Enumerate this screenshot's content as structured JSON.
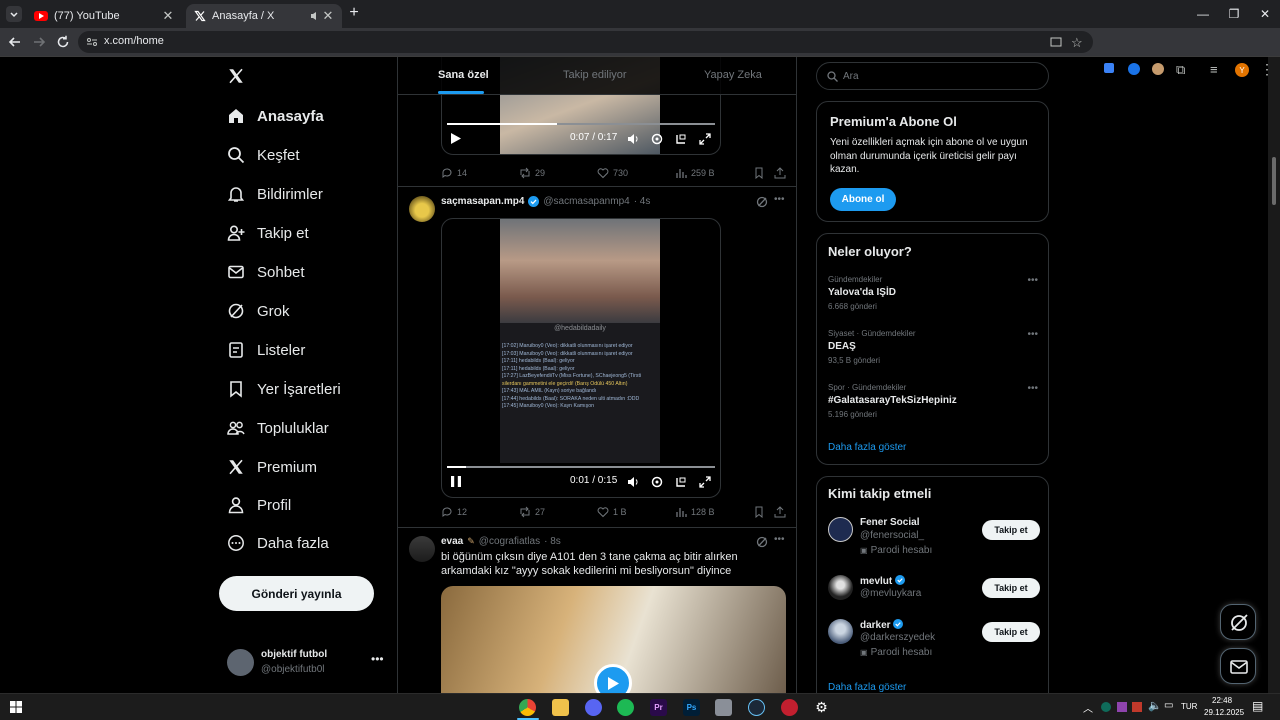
{
  "browser": {
    "tabs": [
      {
        "title": "(77) YouTube",
        "active": false
      },
      {
        "title": "Anasayfa / X",
        "active": true
      }
    ],
    "url": "x.com/home"
  },
  "nav": {
    "items": [
      {
        "label": "Anasayfa",
        "icon": "home-icon"
      },
      {
        "label": "Keşfet",
        "icon": "search-icon"
      },
      {
        "label": "Bildirimler",
        "icon": "bell-icon"
      },
      {
        "label": "Takip et",
        "icon": "person-add-icon"
      },
      {
        "label": "Sohbet",
        "icon": "mail-icon"
      },
      {
        "label": "Grok",
        "icon": "grok-icon"
      },
      {
        "label": "Listeler",
        "icon": "list-icon"
      },
      {
        "label": "Yer İşaretleri",
        "icon": "bookmark-icon"
      },
      {
        "label": "Topluluklar",
        "icon": "people-icon"
      },
      {
        "label": "Premium",
        "icon": "x-logo-icon"
      },
      {
        "label": "Profil",
        "icon": "person-icon"
      },
      {
        "label": "Daha fazla",
        "icon": "more-circle-icon"
      }
    ],
    "post_button": "Gönderi yayınla",
    "account": {
      "name": "objektif futbol",
      "handle": "@objektifutb0l"
    }
  },
  "feed": {
    "tabs": [
      "Sana özel",
      "Takip ediliyor",
      "Yapay Zeka"
    ],
    "posts": [
      {
        "video_time": "0:07 / 0:17",
        "progress": 0.41,
        "replies": "14",
        "reposts": "29",
        "likes": "730",
        "views": "259 B"
      },
      {
        "name": "saçmasapan.mp4",
        "handle": "@sacmasapanmp4",
        "time": "· 4s",
        "watermark": "@hedabildadaily",
        "chat_lines": [
          "[17:02] Maruiboy0 (Veo): dikkatli olunmasını işaret ediyor",
          "[17:03] Maruiboy0 (Veo): dikkatli olunmasını işaret ediyor",
          "[17:11] hedabilds (Baal): geliyor",
          "[17:11] hedabilds (Baal): geliyor",
          "[17:27] LazBeyefendiiTv (Miss Fortune), SChaejeong5 (Tirsti",
          "silerdanı gammetini ele geçirdi! (Barış Ödülü 450 Altın)",
          "[17:43] MAL AMİL (Kayn) soriye bağlandı",
          "[17:44] hedabilds (Baal): SORAKA neden ulti atmadın :DDD",
          "[17:45] Maruiboy0 (Veo): Kayn Kamışon"
        ],
        "video_time": "0:01 / 0:15",
        "progress": 0.07,
        "replies": "12",
        "reposts": "27",
        "likes": "1 B",
        "views": "128 B"
      },
      {
        "name": "evaa",
        "handle": "@cografiatlas",
        "time": "· 8s",
        "text": "bi öğünüm çıksın diye A101 den 3 tane çakma aç bitir alırken arkamdaki kız \"ayyy sokak kedilerini mi besliyorsun\" diyince"
      }
    ]
  },
  "sidebar": {
    "search_placeholder": "Ara",
    "premium": {
      "title": "Premium'a Abone Ol",
      "text": "Yeni özellikleri açmak için abone ol ve uygun olman durumunda içerik üreticisi gelir payı kazan.",
      "button": "Abone ol"
    },
    "trends": {
      "title": "Neler oluyor?",
      "items": [
        {
          "category": "Gündemdekiler",
          "title": "Yalova'da IŞİD",
          "count": "6.668 gönderi"
        },
        {
          "category": "Siyaset · Gündemdekiler",
          "title": "DEAŞ",
          "count": "93,5 B gönderi"
        },
        {
          "category": "Spor · Gündemdekiler",
          "title": "#GalatasarayTekSizHepiniz",
          "count": "5.196 gönderi"
        }
      ],
      "more": "Daha fazla göster"
    },
    "who_to_follow": {
      "title": "Kimi takip etmeli",
      "items": [
        {
          "name": "Fener Social",
          "handle": "@fenersocial_",
          "note": "Parodi hesabı",
          "verified": false,
          "button": "Takip et"
        },
        {
          "name": "mevlut",
          "handle": "@mevluykara",
          "note": "",
          "verified": true,
          "button": "Takip et"
        },
        {
          "name": "darker",
          "handle": "@darkerszyedek",
          "note": "Parodi hesabı",
          "verified": true,
          "button": "Takip et"
        }
      ],
      "more": "Daha fazla göster"
    }
  },
  "taskbar": {
    "lang": "TUR",
    "time": "22:48",
    "date": "29.12.2025"
  },
  "colors": {
    "accent": "#1d9bf0",
    "background": "#000000",
    "border": "#2f3336",
    "muted": "#71767b"
  }
}
